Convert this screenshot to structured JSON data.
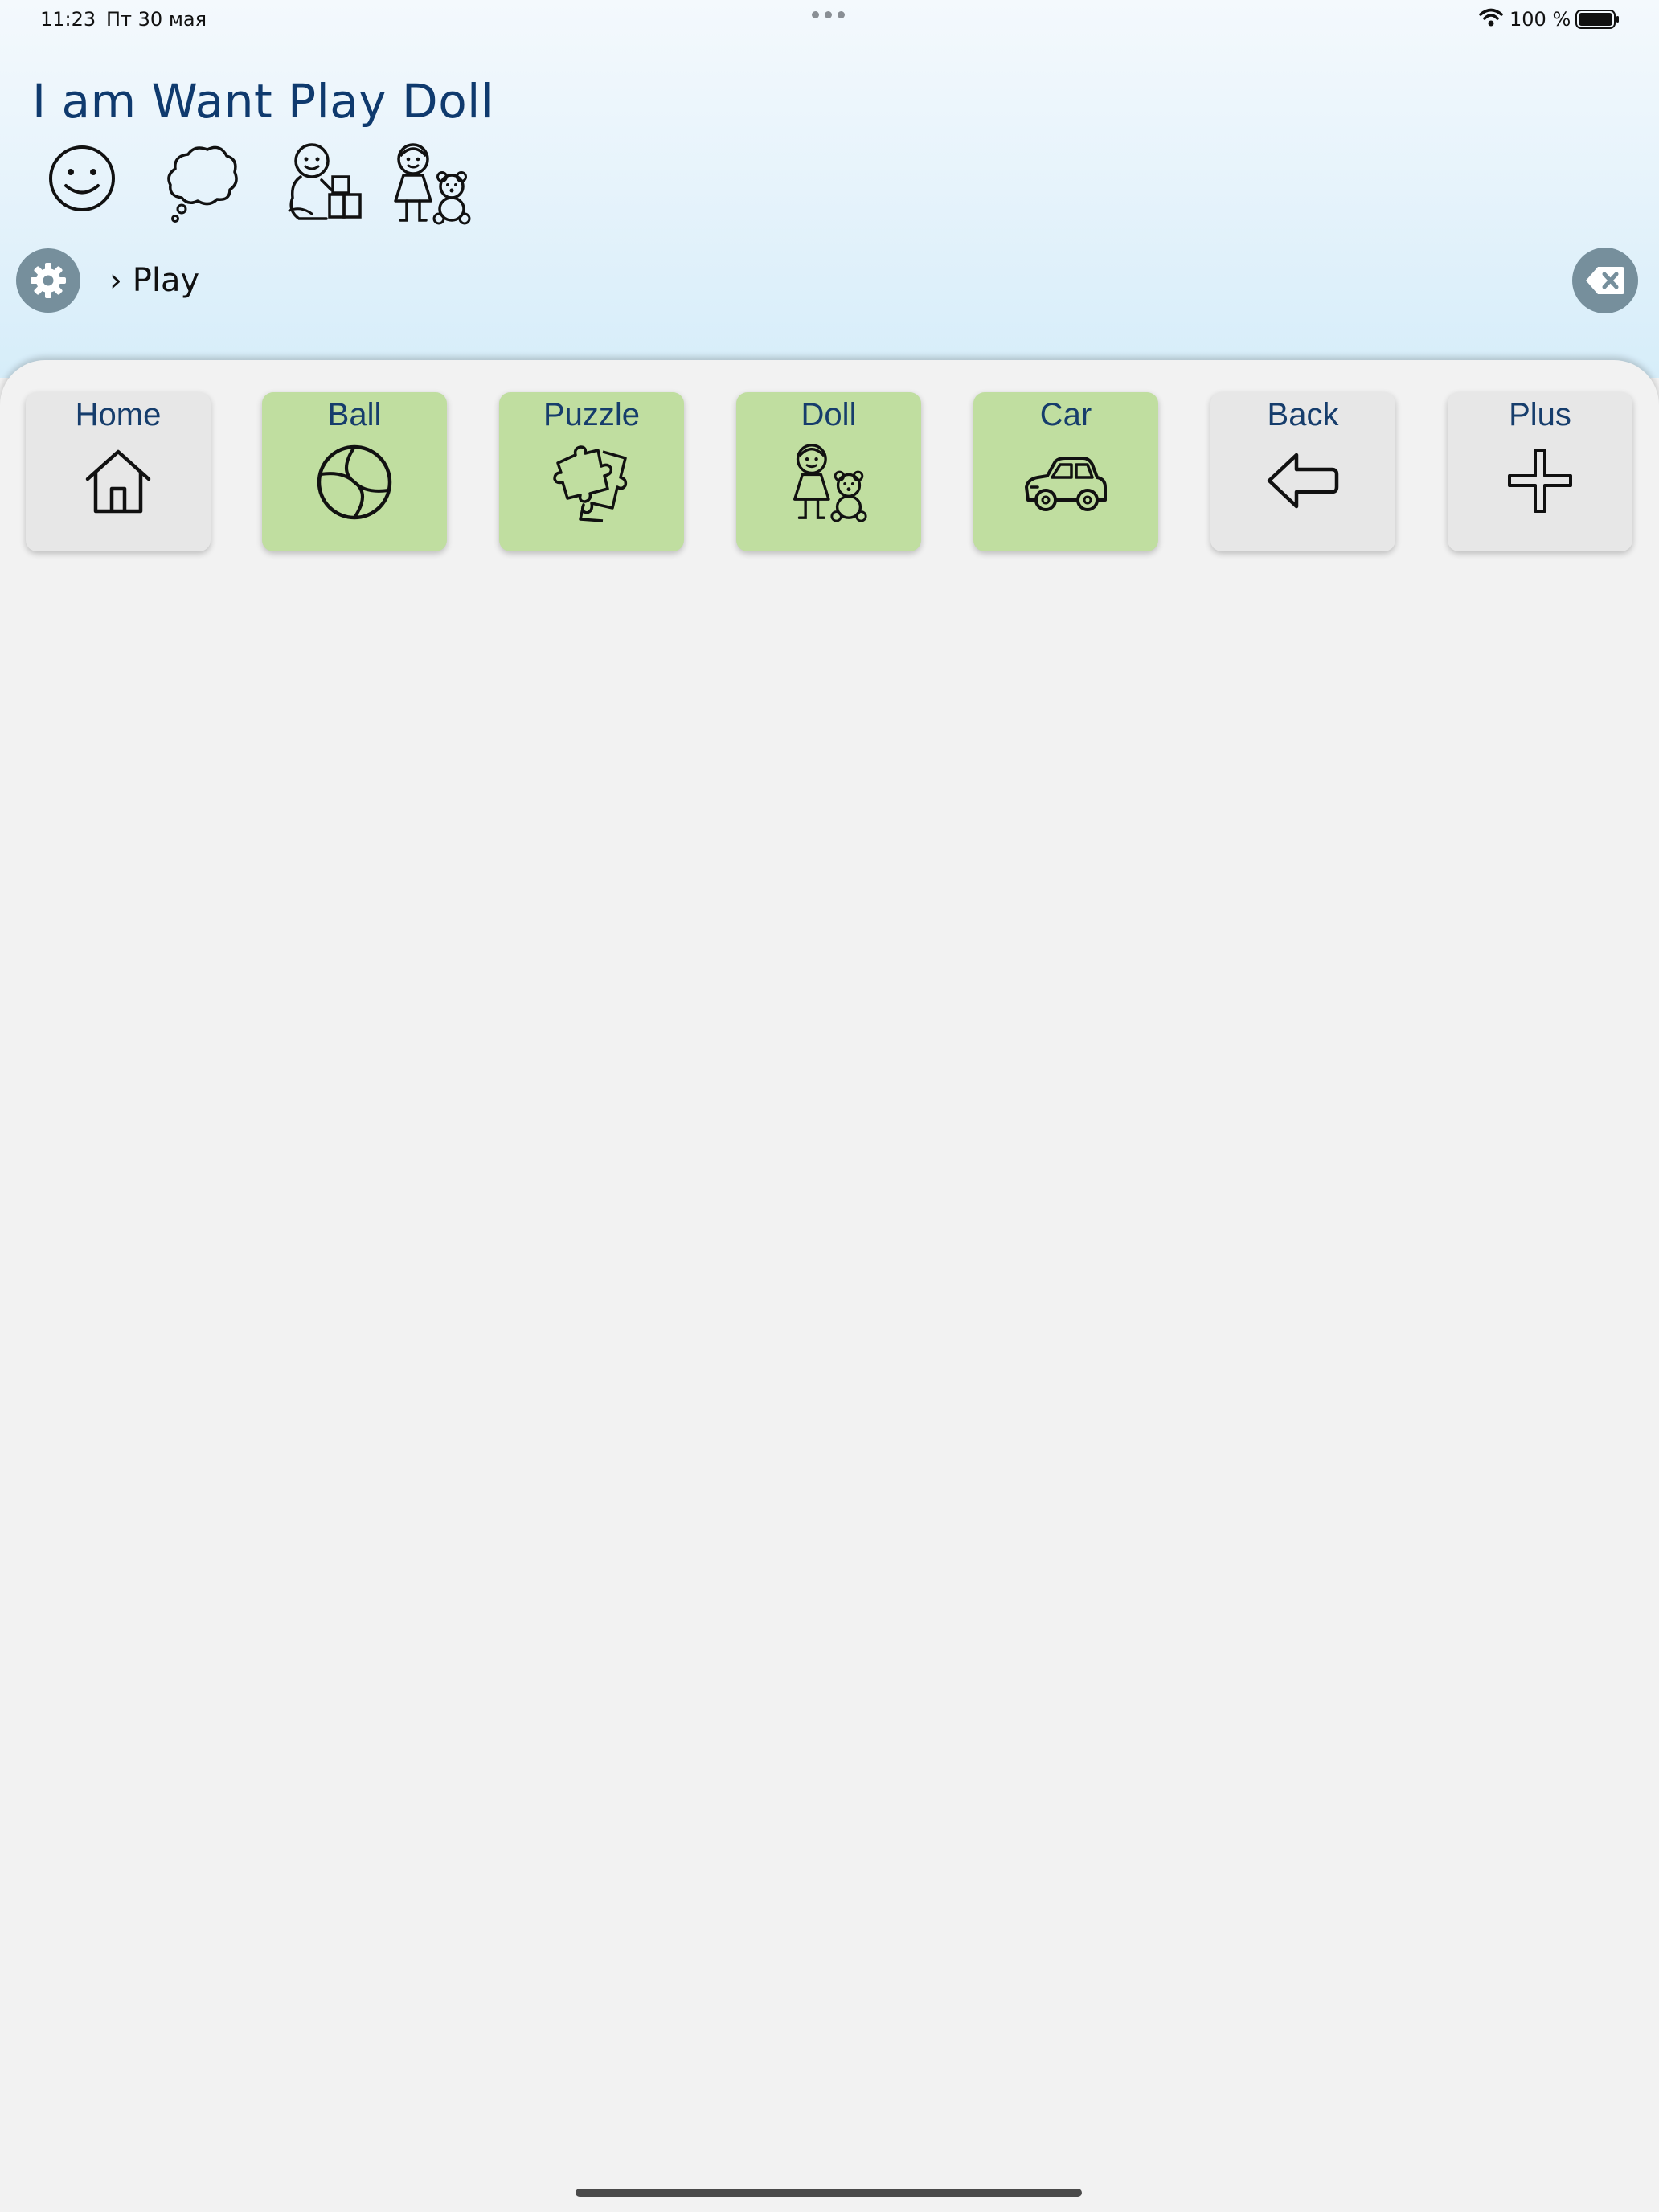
{
  "status_bar": {
    "time": "11:23",
    "date": "Пт 30 мая",
    "battery": "100 %"
  },
  "sentence": {
    "text": "I am Want Play Doll",
    "symbols": [
      "smile-face-icon",
      "thought-cloud-icon",
      "child-playing-blocks-icon",
      "girl-teddy-bear-icon"
    ]
  },
  "breadcrumb": {
    "separator": "›",
    "current": "Play"
  },
  "tiles": [
    {
      "label": "Home",
      "icon": "house-icon",
      "kind": "nav"
    },
    {
      "label": "Ball",
      "icon": "ball-icon",
      "kind": "item"
    },
    {
      "label": "Puzzle",
      "icon": "puzzle-icon",
      "kind": "item"
    },
    {
      "label": "Doll",
      "icon": "girl-teddy-bear-icon",
      "kind": "item"
    },
    {
      "label": "Car",
      "icon": "car-icon",
      "kind": "item"
    },
    {
      "label": "Back",
      "icon": "arrow-left-icon",
      "kind": "nav"
    },
    {
      "label": "Plus",
      "icon": "plus-icon",
      "kind": "nav"
    }
  ],
  "colors": {
    "item_tile": "#c0dea0",
    "nav_tile": "#e7e7e7",
    "label_text": "#163d6c",
    "round_button": "#768f9c"
  }
}
